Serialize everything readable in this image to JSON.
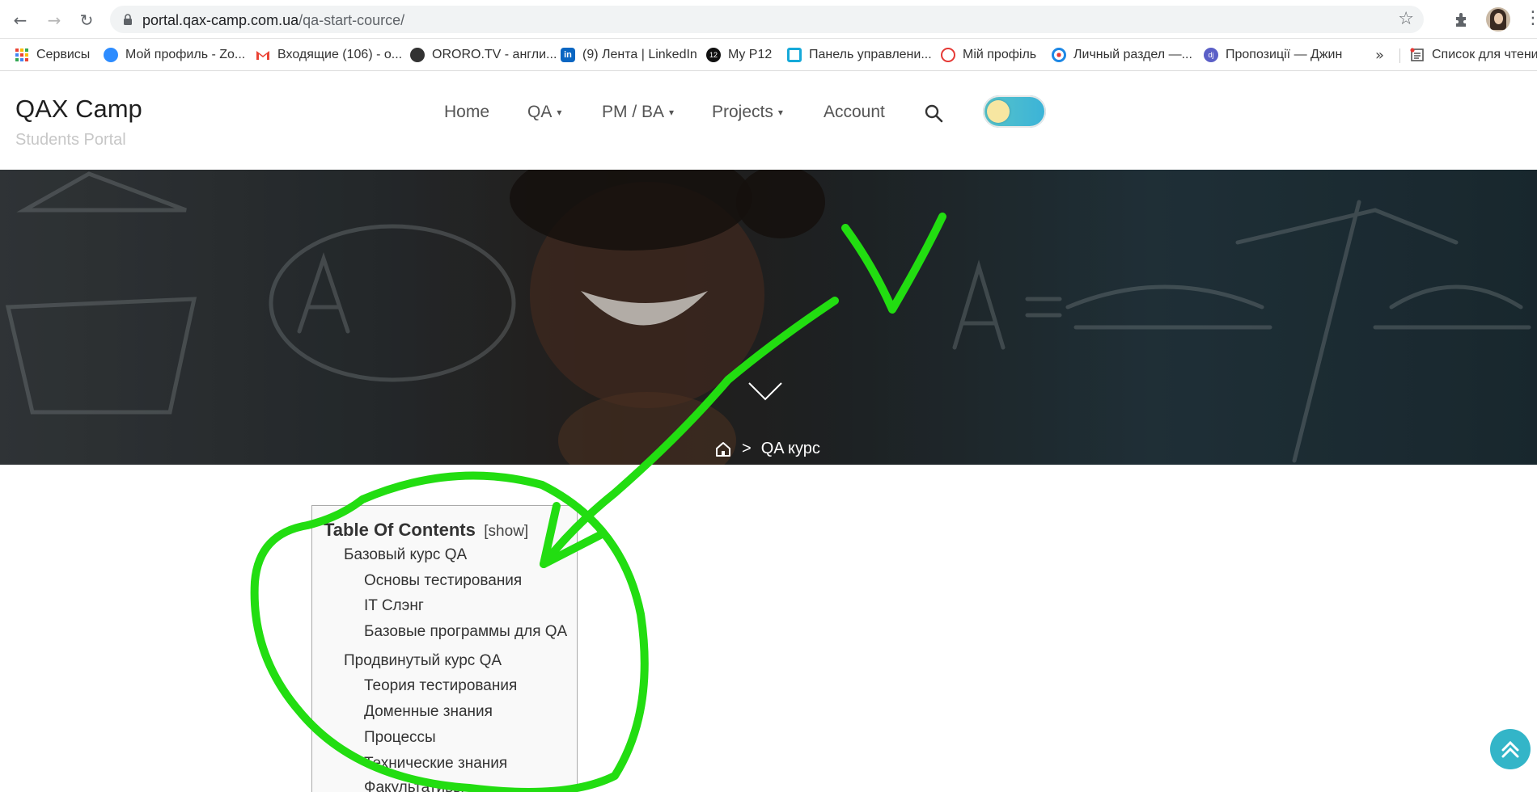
{
  "browser": {
    "url_host": "portal.qax-camp.com.ua",
    "url_path": "/qa-start-cource/"
  },
  "bookmarks": [
    {
      "label": "Сервисы",
      "icon": "apps-grid-icon",
      "color": "#ea4335"
    },
    {
      "label": "Мой профиль - Zo...",
      "icon": "zoom-icon",
      "color": "#2d8cff"
    },
    {
      "label": "Входящие (106) - o...",
      "icon": "gmail-icon",
      "color": "#ea4335"
    },
    {
      "label": "ORORO.TV - англи...",
      "icon": "ororo-icon",
      "color": "#333333"
    },
    {
      "label": "(9) Лента | LinkedIn",
      "icon": "linkedin-icon",
      "color": "#0a66c2"
    },
    {
      "label": "My P12",
      "icon": "p12-icon",
      "color": "#111111"
    },
    {
      "label": "Панель управлени...",
      "icon": "panel-icon",
      "color": "#16a9d9"
    },
    {
      "label": "Мій профіль",
      "icon": "profile-r-icon",
      "color": "#e53935"
    },
    {
      "label": "Личный раздел —...",
      "icon": "target-icon",
      "color": "#1e88e5"
    },
    {
      "label": "Пропозиції — Джин",
      "icon": "djinni-icon",
      "color": "#5b5fc7"
    }
  ],
  "bookmarks_more": "»",
  "reading_list": "Список для чтения",
  "site": {
    "title": "QAX Camp",
    "tagline": "Students Portal"
  },
  "menu": [
    {
      "label": "Home",
      "has_caret": false
    },
    {
      "label": "QA",
      "has_caret": true
    },
    {
      "label": "PM / BA",
      "has_caret": true
    },
    {
      "label": "Projects",
      "has_caret": true
    },
    {
      "label": "Account",
      "has_caret": false
    }
  ],
  "caret": "▾",
  "breadcrumb": {
    "separator": ">",
    "current": "QA курс"
  },
  "toc": {
    "title": "Table Of Contents",
    "toggle": "[show]",
    "items": [
      {
        "label": "Базовый курс QA",
        "level": 1
      },
      {
        "label": "Основы тестирования",
        "level": 2
      },
      {
        "label": "IT Слэнг",
        "level": 2
      },
      {
        "label": "Базовые программы для QA",
        "level": 2
      },
      {
        "label": "Продвинутый курс QA",
        "level": 1
      },
      {
        "label": "Теория тестирования",
        "level": 2
      },
      {
        "label": "Доменные знания",
        "level": 2
      },
      {
        "label": "Процессы",
        "level": 2
      },
      {
        "label": "Технические знания",
        "level": 2
      },
      {
        "label": "Факультативы",
        "level": 2
      }
    ]
  },
  "colors": {
    "annotation": "#22dd11",
    "toggle": "#3bb3d8",
    "back_to_top": "#33b5c8"
  }
}
